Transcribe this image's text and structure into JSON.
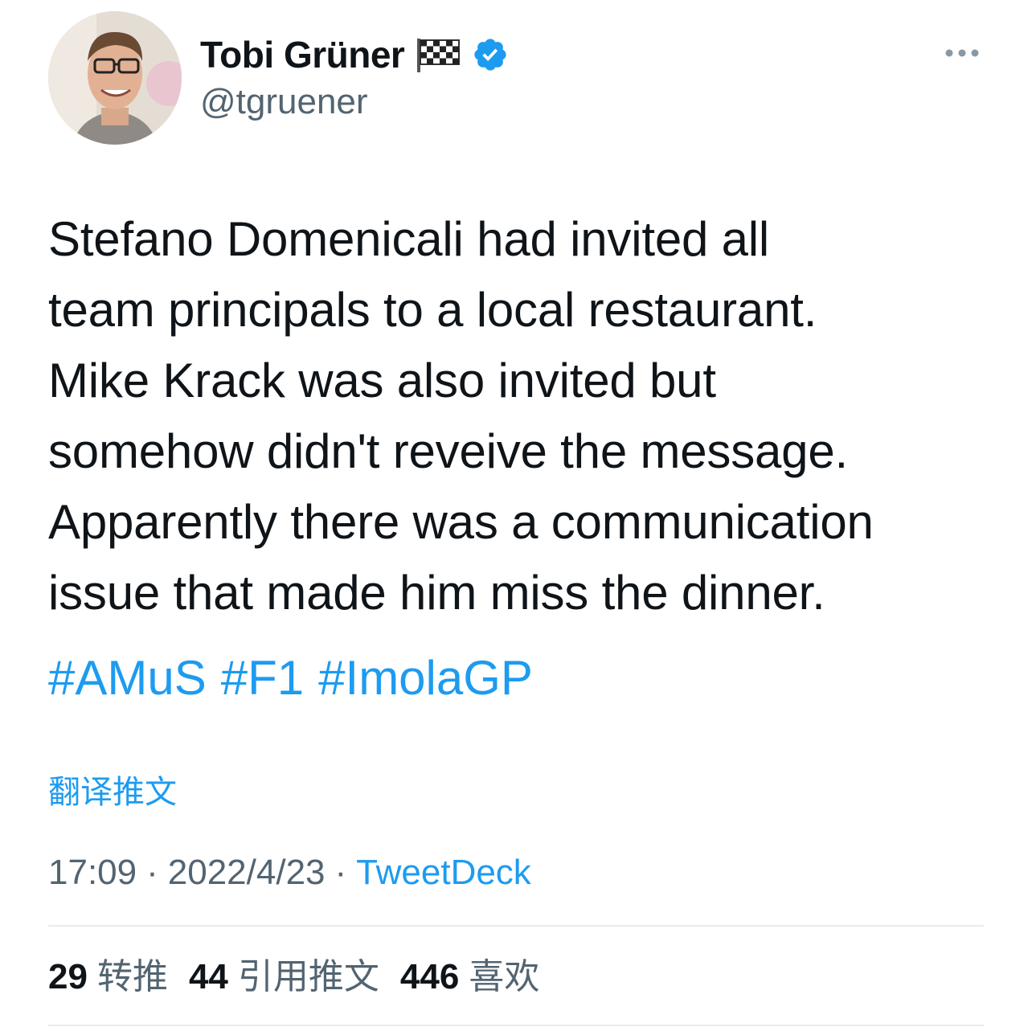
{
  "author": {
    "name": "Tobi Grüner",
    "handle": "@tgruener",
    "emoji_icon": "chequered-flag-icon",
    "verified_icon": "verified-badge-icon"
  },
  "tweet": {
    "text": "Stefano Domenicali had invited all\nteam principals to a local restaurant.\nMike Krack was also invited but\nsomehow didn't reveive the message.\nApparently there was a communication\nissue that made him miss the dinner.",
    "hashtags": [
      "#AMuS",
      "#F1",
      "#ImolaGP"
    ],
    "translate_label": "翻译推文"
  },
  "meta": {
    "time": "17:09",
    "separator": "·",
    "date": "2022/4/23",
    "source": "TweetDeck"
  },
  "stats": {
    "retweets_count": "29",
    "retweets_label": "转推",
    "quotes_count": "44",
    "quotes_label": "引用推文",
    "likes_count": "446",
    "likes_label": "喜欢"
  },
  "colors": {
    "accent": "#1d9bf0",
    "secondary_text": "#536471",
    "divider": "#e6ecf0"
  }
}
